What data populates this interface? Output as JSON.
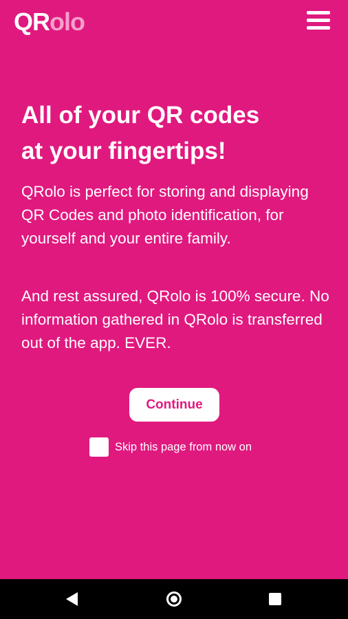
{
  "colors": {
    "background": "#e0197f",
    "text": "#ffffff",
    "logo_accent": "#f59fcb",
    "button_bg": "#ffffff",
    "button_text": "#e0197f",
    "navbar": "#000000"
  },
  "header": {
    "logo_part1": "QR",
    "logo_part2": "olo",
    "menu_icon": "hamburger-menu-icon"
  },
  "main": {
    "headline_line1": "All of your QR codes",
    "headline_line2": "at your fingertips!",
    "paragraph1": "QRolo is perfect for storing and displaying QR Codes and photo identification, for yourself and your entire family.",
    "paragraph2": "And rest assured, QRolo is 100% secure. No information gathered in QRolo is transferred out of the app. EVER.",
    "continue_label": "Continue",
    "skip_label": "Skip this page from now on",
    "skip_checked": false
  },
  "system_nav": {
    "back_icon": "back-triangle-icon",
    "home_icon": "home-circle-icon",
    "recents_icon": "recents-square-icon"
  }
}
